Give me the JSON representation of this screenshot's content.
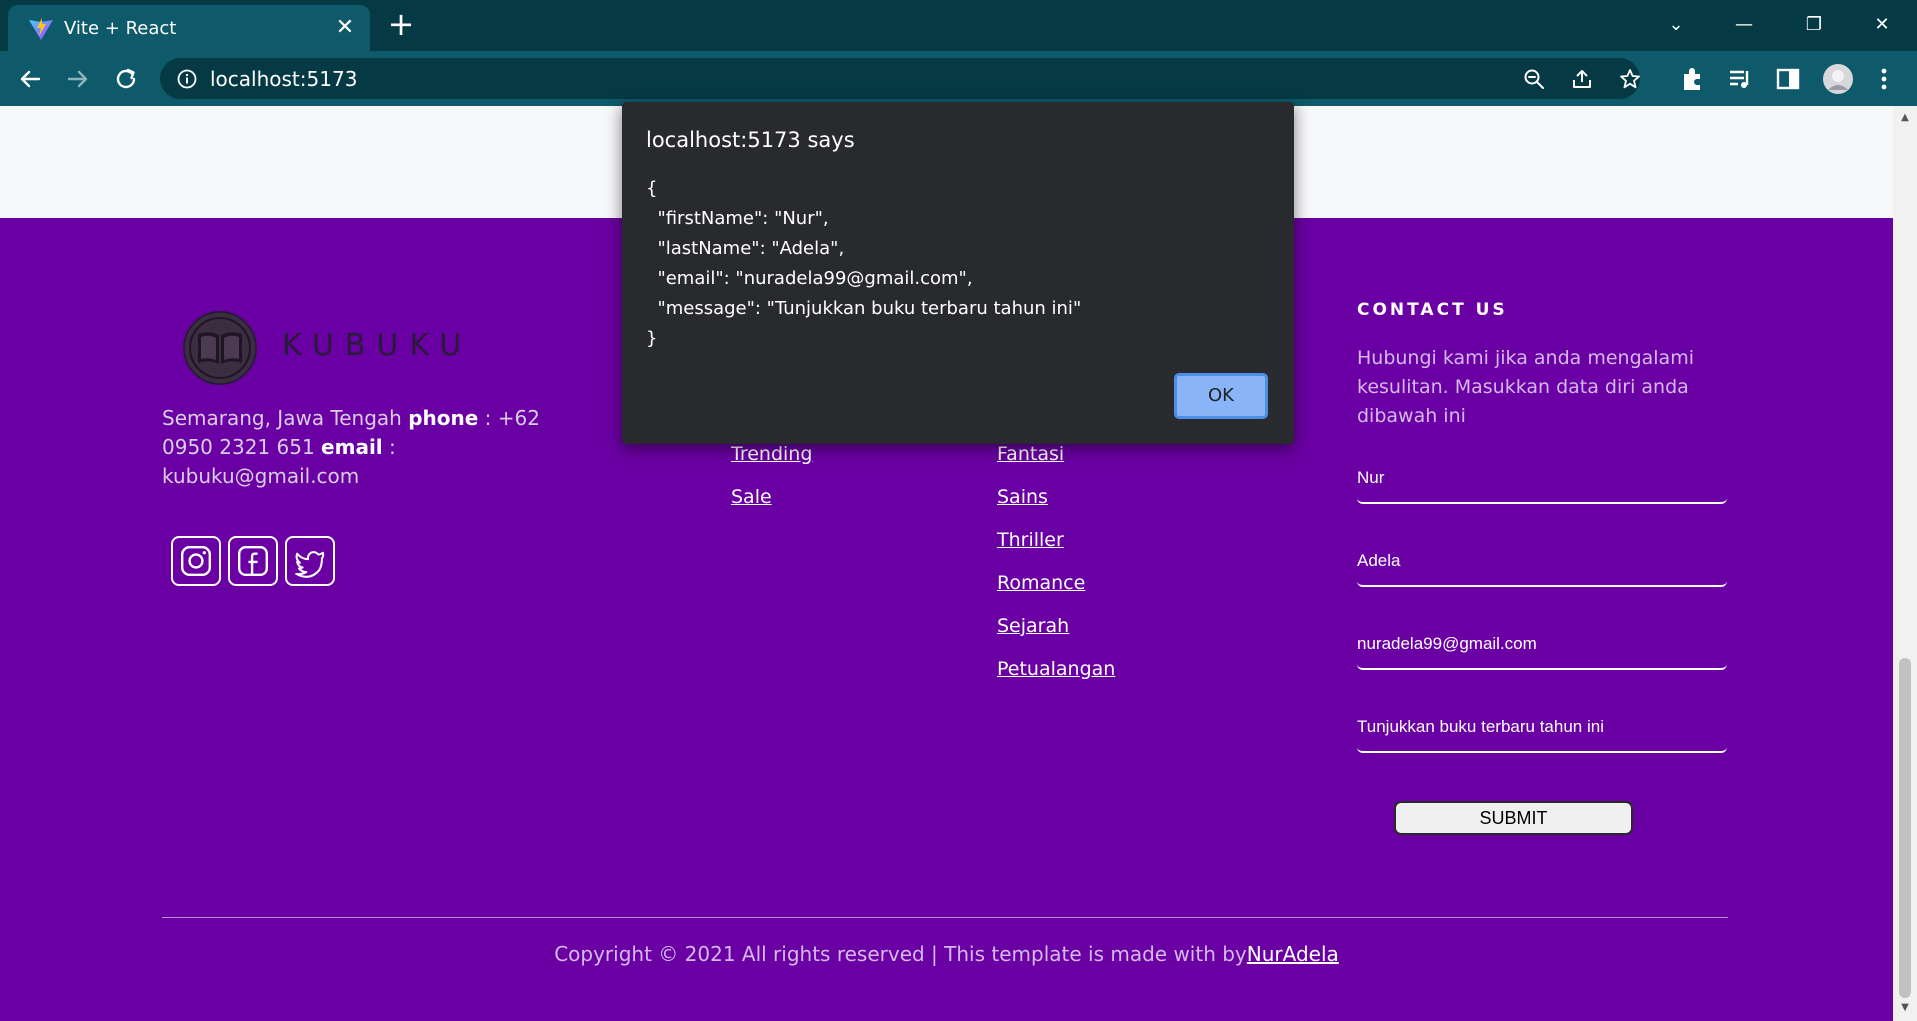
{
  "browser": {
    "tab_title": "Vite + React",
    "url": "localhost:5173",
    "accent": "#0e5a6a"
  },
  "footer": {
    "brand": "KUBUKU",
    "address": {
      "location": "Semarang, Jawa Tengah",
      "phone_label": "phone",
      "phone": " : +62 0950 2321 651 ",
      "email_label": "email",
      "email": " : kubuku@gmail.com"
    },
    "social_icons": [
      "instagram-icon",
      "facebook-icon",
      "twitter-icon"
    ],
    "links_col1": [
      "Trending",
      "Sale"
    ],
    "links_col2": [
      "Fantasi",
      "Sains",
      "Thriller",
      "Romance",
      "Sejarah",
      "Petualangan"
    ],
    "contact": {
      "title": "CONTACT US",
      "description": "Hubungi kami jika anda mengalami kesulitan. Masukkan data diri anda dibawah ini",
      "first_name": "Nur",
      "last_name": "Adela",
      "email": "nuradela99@gmail.com",
      "message": "Tunjukkan buku terbaru tahun ini",
      "submit_label": "SUBMIT"
    },
    "copyright_text": "Copyright © 2021 All rights reserved | This template is made with by",
    "copyright_author": "NurAdela",
    "background": "#6a00a3"
  },
  "dialog": {
    "title": "localhost:5173 says",
    "body": "{\n  \"firstName\": \"Nur\",\n  \"lastName\": \"Adela\",\n  \"email\": \"nuradela99@gmail.com\",\n  \"message\": \"Tunjukkan buku terbaru tahun ini\"\n}",
    "ok_label": "OK"
  }
}
